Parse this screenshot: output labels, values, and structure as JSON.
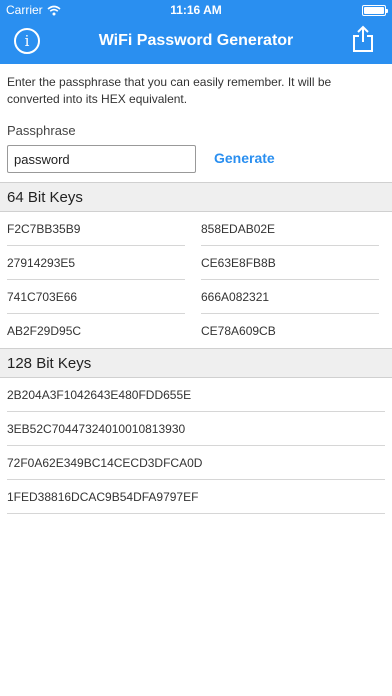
{
  "status": {
    "carrier": "Carrier",
    "time": "11:16 AM"
  },
  "nav": {
    "title": "WiFi Password Generator",
    "info_glyph": "i"
  },
  "intro_text": "Enter the passphrase that you can easily remember. It will be converted into its HEX equivalent.",
  "passphrase": {
    "label": "Passphrase",
    "value": "password"
  },
  "generate_label": "Generate",
  "keys64": {
    "header": "64 Bit Keys",
    "left": [
      "F2C7BB35B9",
      "27914293E5",
      "741C703E66",
      "AB2F29D95C"
    ],
    "right": [
      "858EDAB02E",
      "CE63E8FB8B",
      "666A082321",
      "CE78A609CB"
    ]
  },
  "keys128": {
    "header": "128 Bit Keys",
    "items": [
      "2B204A3F1042643E480FDD655E",
      "3EB52C70447324010010813930",
      "72F0A62E349BC14CECD3DFCA0D",
      "1FED38816DCAC9B54DFA9797EF"
    ]
  },
  "colors": {
    "accent": "#2a8ff0",
    "section_bg": "#efefef"
  },
  "icons": {
    "wifi": "wifi-icon",
    "battery": "battery-icon",
    "info": "info-icon",
    "share": "share-icon"
  }
}
